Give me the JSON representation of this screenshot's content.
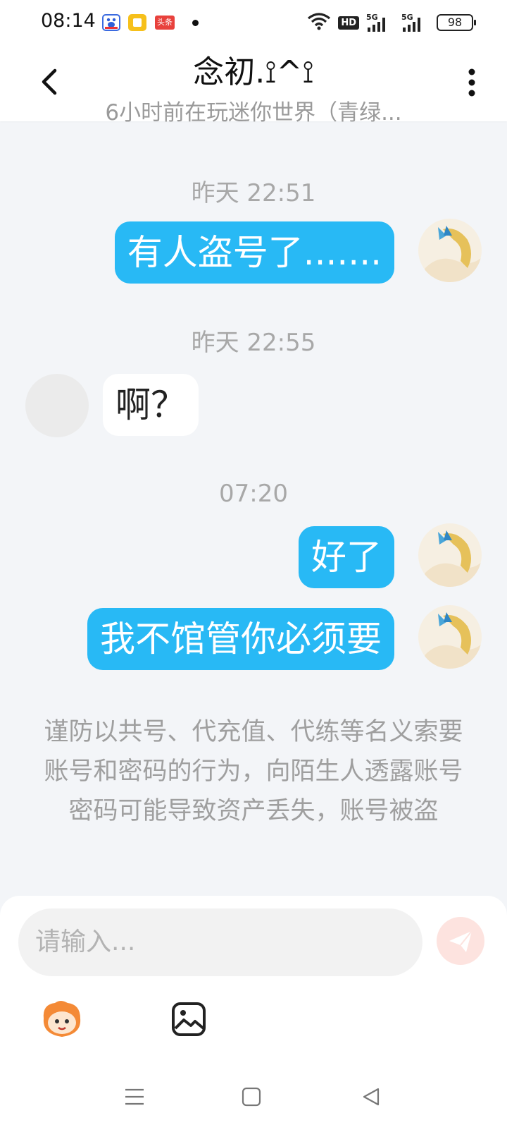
{
  "status_bar": {
    "time": "08:14",
    "notif_label": "头条",
    "hd_label": "HD",
    "net1": "5G",
    "net2": "5G",
    "battery": "98"
  },
  "header": {
    "title": "念初.⟟^⟟",
    "subtitle": "6小时前在玩迷你世界（青绿..."
  },
  "messages": [
    {
      "type": "time",
      "text": "昨天 22:51"
    },
    {
      "type": "out",
      "text": "有人盗号了......."
    },
    {
      "type": "time",
      "text": "昨天 22:55"
    },
    {
      "type": "in",
      "text": "啊？"
    },
    {
      "type": "time",
      "text": "07:20"
    },
    {
      "type": "out",
      "text": "好了"
    },
    {
      "type": "out",
      "text": "我不馆管你必须要"
    }
  ],
  "notice": "谨防以共号、代充值、代练等名义索要账号和密码的行为，向陌生人透露账号密码可能导致资产丢失，账号被盗",
  "input": {
    "placeholder": "请输入..."
  },
  "colors": {
    "bubble_out": "#28b9f5",
    "send_button": "#fde3df",
    "background": "#f3f5f8"
  },
  "icons": [
    "back-icon",
    "more-icon",
    "send-icon",
    "emoji-icon",
    "image-icon",
    "menu-icon",
    "home-icon",
    "back-triangle-icon"
  ]
}
